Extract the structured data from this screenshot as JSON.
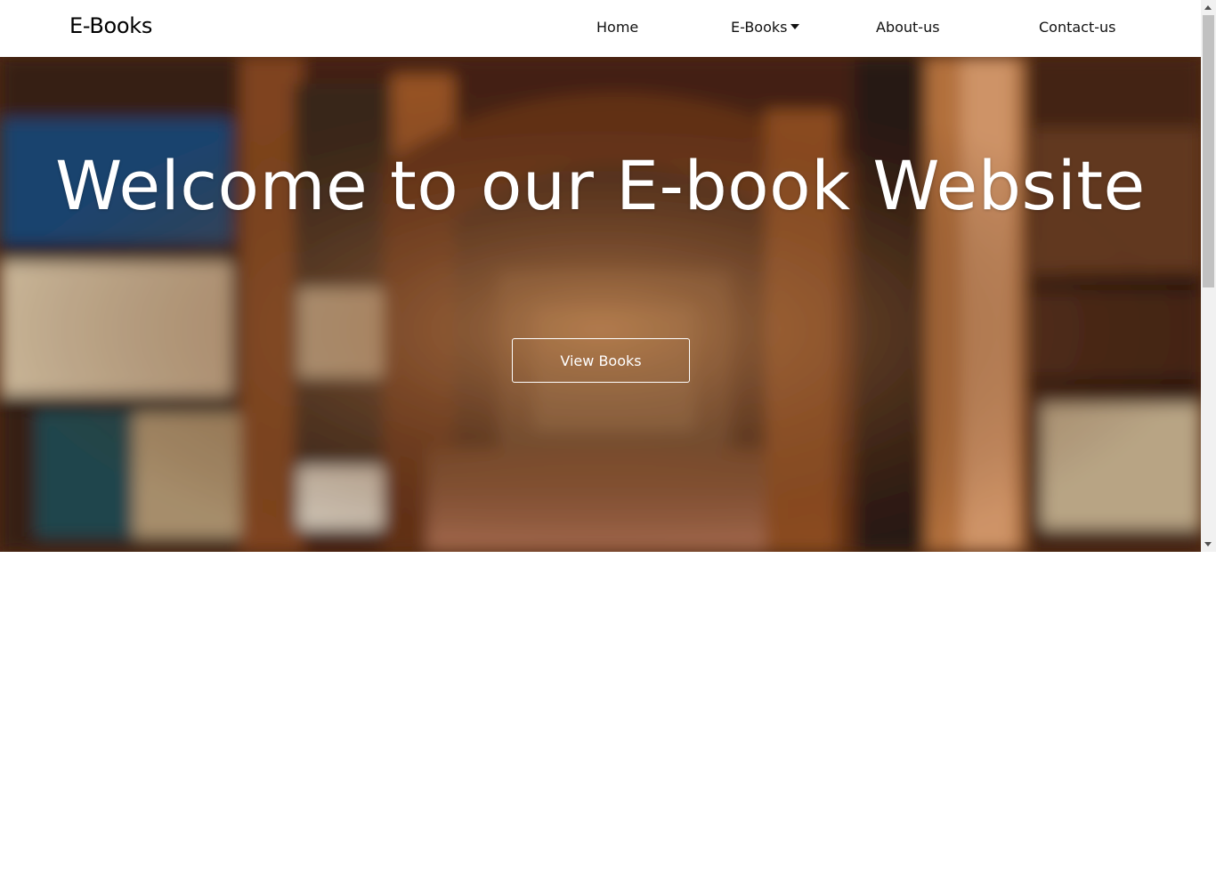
{
  "navbar": {
    "brand": "E-Books",
    "links": [
      {
        "label": "Home"
      },
      {
        "label": "E-Books",
        "has_dropdown": true
      },
      {
        "label": "About-us"
      },
      {
        "label": "Contact-us"
      }
    ]
  },
  "hero": {
    "title": "Welcome to our E-book Website",
    "button_label": "View Books"
  },
  "colors": {
    "nav_background": "#ffffff",
    "hero_text": "#ffffff",
    "hero_overlay_tone": "#6b3a1e",
    "page_background": "#ffffff"
  }
}
